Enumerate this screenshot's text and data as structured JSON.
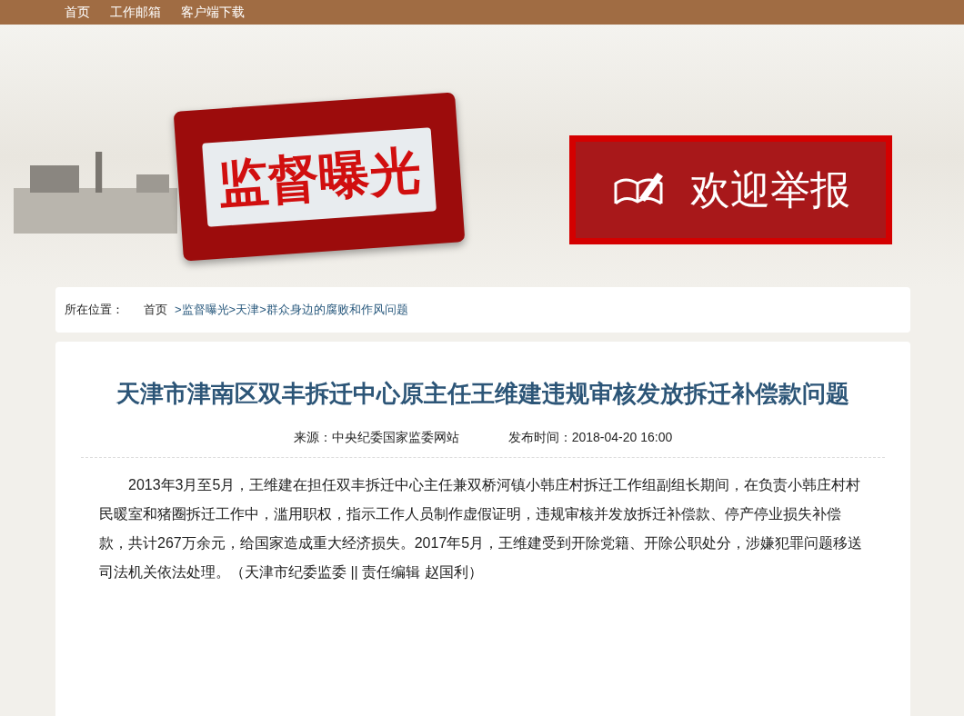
{
  "top_nav": [
    {
      "label": "首页"
    },
    {
      "label": "工作邮箱"
    },
    {
      "label": "客户端下载"
    }
  ],
  "banner": {
    "title": "监督曝光",
    "report_button": "欢迎举报"
  },
  "breadcrumb": {
    "label": "所在位置：",
    "items": [
      "首页",
      ">监督曝光",
      ">天津",
      ">群众身边的腐败和作风问题"
    ]
  },
  "article": {
    "title": "天津市津南区双丰拆迁中心原主任王维建违规审核发放拆迁补偿款问题",
    "source": "来源：中央纪委国家监委网站",
    "published": "发布时间：2018-04-20 16:00",
    "body": "2013年3月至5月，王维建在担任双丰拆迁中心主任兼双桥河镇小韩庄村拆迁工作组副组长期间，在负责小韩庄村村民暖室和猪圈拆迁工作中，滥用职权，指示工作人员制作虚假证明，违规审核并发放拆迁补偿款、停产停业损失补偿款，共计267万余元，给国家造成重大经济损失。2017年5月，王维建受到开除党籍、开除公职处分，涉嫌犯罪问题移送司法机关依法处理。（天津市纪委监委 || 责任编辑 赵国利）"
  }
}
